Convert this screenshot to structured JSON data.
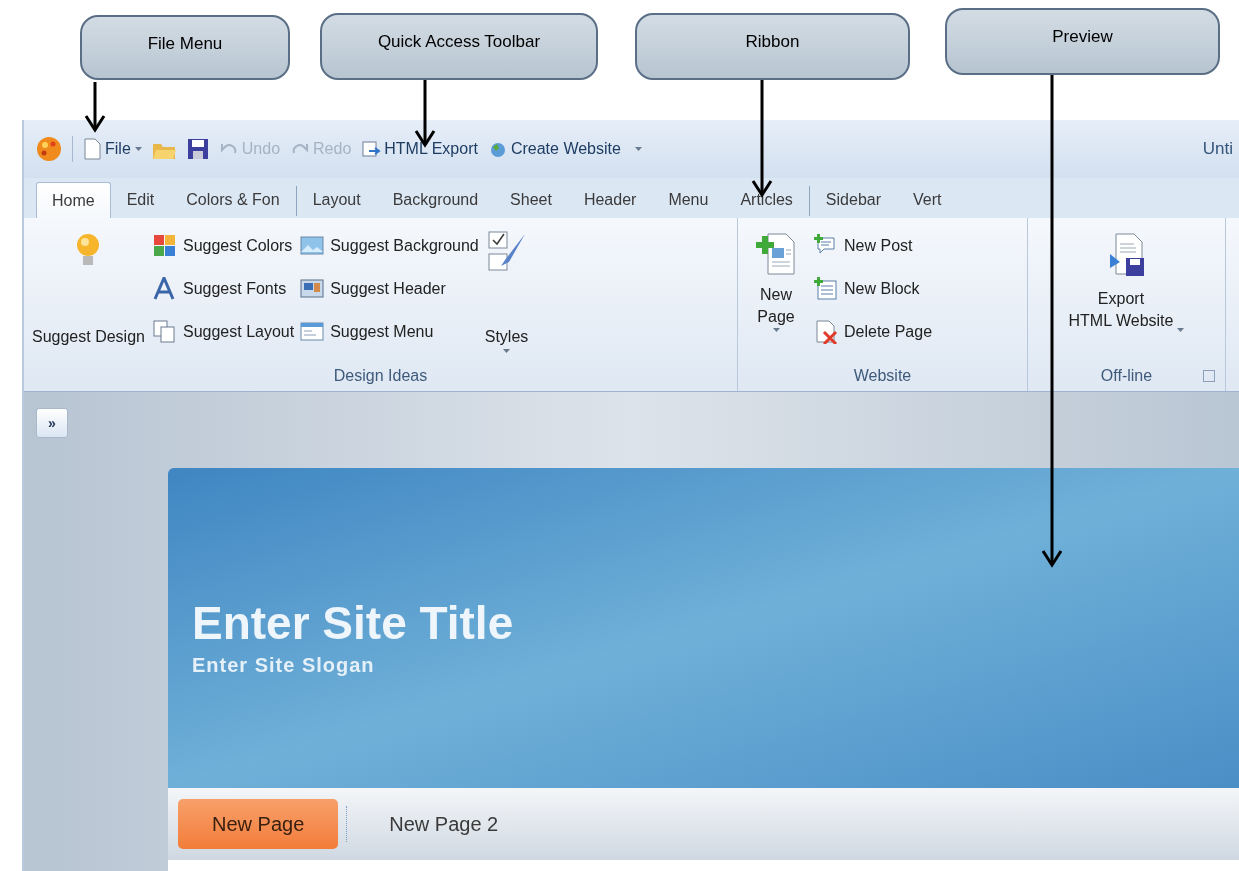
{
  "callouts": [
    {
      "label": "File Menu"
    },
    {
      "label": "Quick Access Toolbar"
    },
    {
      "label": "Ribbon"
    },
    {
      "label": "Preview"
    }
  ],
  "quick_access": {
    "file_menu": {
      "label": "File"
    },
    "undo": {
      "label": "Undo",
      "disabled": true
    },
    "redo": {
      "label": "Redo",
      "disabled": true
    },
    "html_export": {
      "label": "HTML Export",
      "disabled": false
    },
    "create_website": {
      "label": "Create Website",
      "disabled": false
    }
  },
  "window_title": "Unti",
  "tab_groups": [
    {
      "tabs": [
        {
          "label": "Home",
          "selected": true
        },
        {
          "label": "Edit",
          "selected": false
        },
        {
          "label": "Colors & Fon",
          "selected": false
        }
      ]
    },
    {
      "tabs": [
        {
          "label": "Layout",
          "selected": false
        },
        {
          "label": "Background",
          "selected": false
        },
        {
          "label": "Sheet",
          "selected": false
        },
        {
          "label": "Header",
          "selected": false
        },
        {
          "label": "Menu",
          "selected": false
        },
        {
          "label": "Articles",
          "selected": false
        }
      ]
    },
    {
      "tabs": [
        {
          "label": "Sidebar",
          "selected": false
        },
        {
          "label": "Vert",
          "selected": false
        }
      ]
    }
  ],
  "design_ideas": {
    "label": "Design Ideas",
    "suggest_design": "Suggest Design",
    "column_1": [
      "Suggest Colors",
      "Suggest Fonts",
      "Suggest Layout"
    ],
    "column_2": [
      "Suggest Background",
      "Suggest Header",
      "Suggest Menu"
    ],
    "styles": "Styles"
  },
  "website": {
    "label": "Website",
    "new_page": "New\nPage",
    "actions": [
      "New Post",
      "New Block",
      "Delete Page"
    ]
  },
  "offline": {
    "label": "Off-line",
    "export": "Export\nHTML Website"
  },
  "preview": {
    "expand_button": "»",
    "site_title": "Enter Site Title",
    "site_slogan": "Enter Site Slogan",
    "menu": [
      {
        "label": "New Page",
        "selected": true
      },
      {
        "label": "New Page 2",
        "selected": false
      }
    ]
  }
}
